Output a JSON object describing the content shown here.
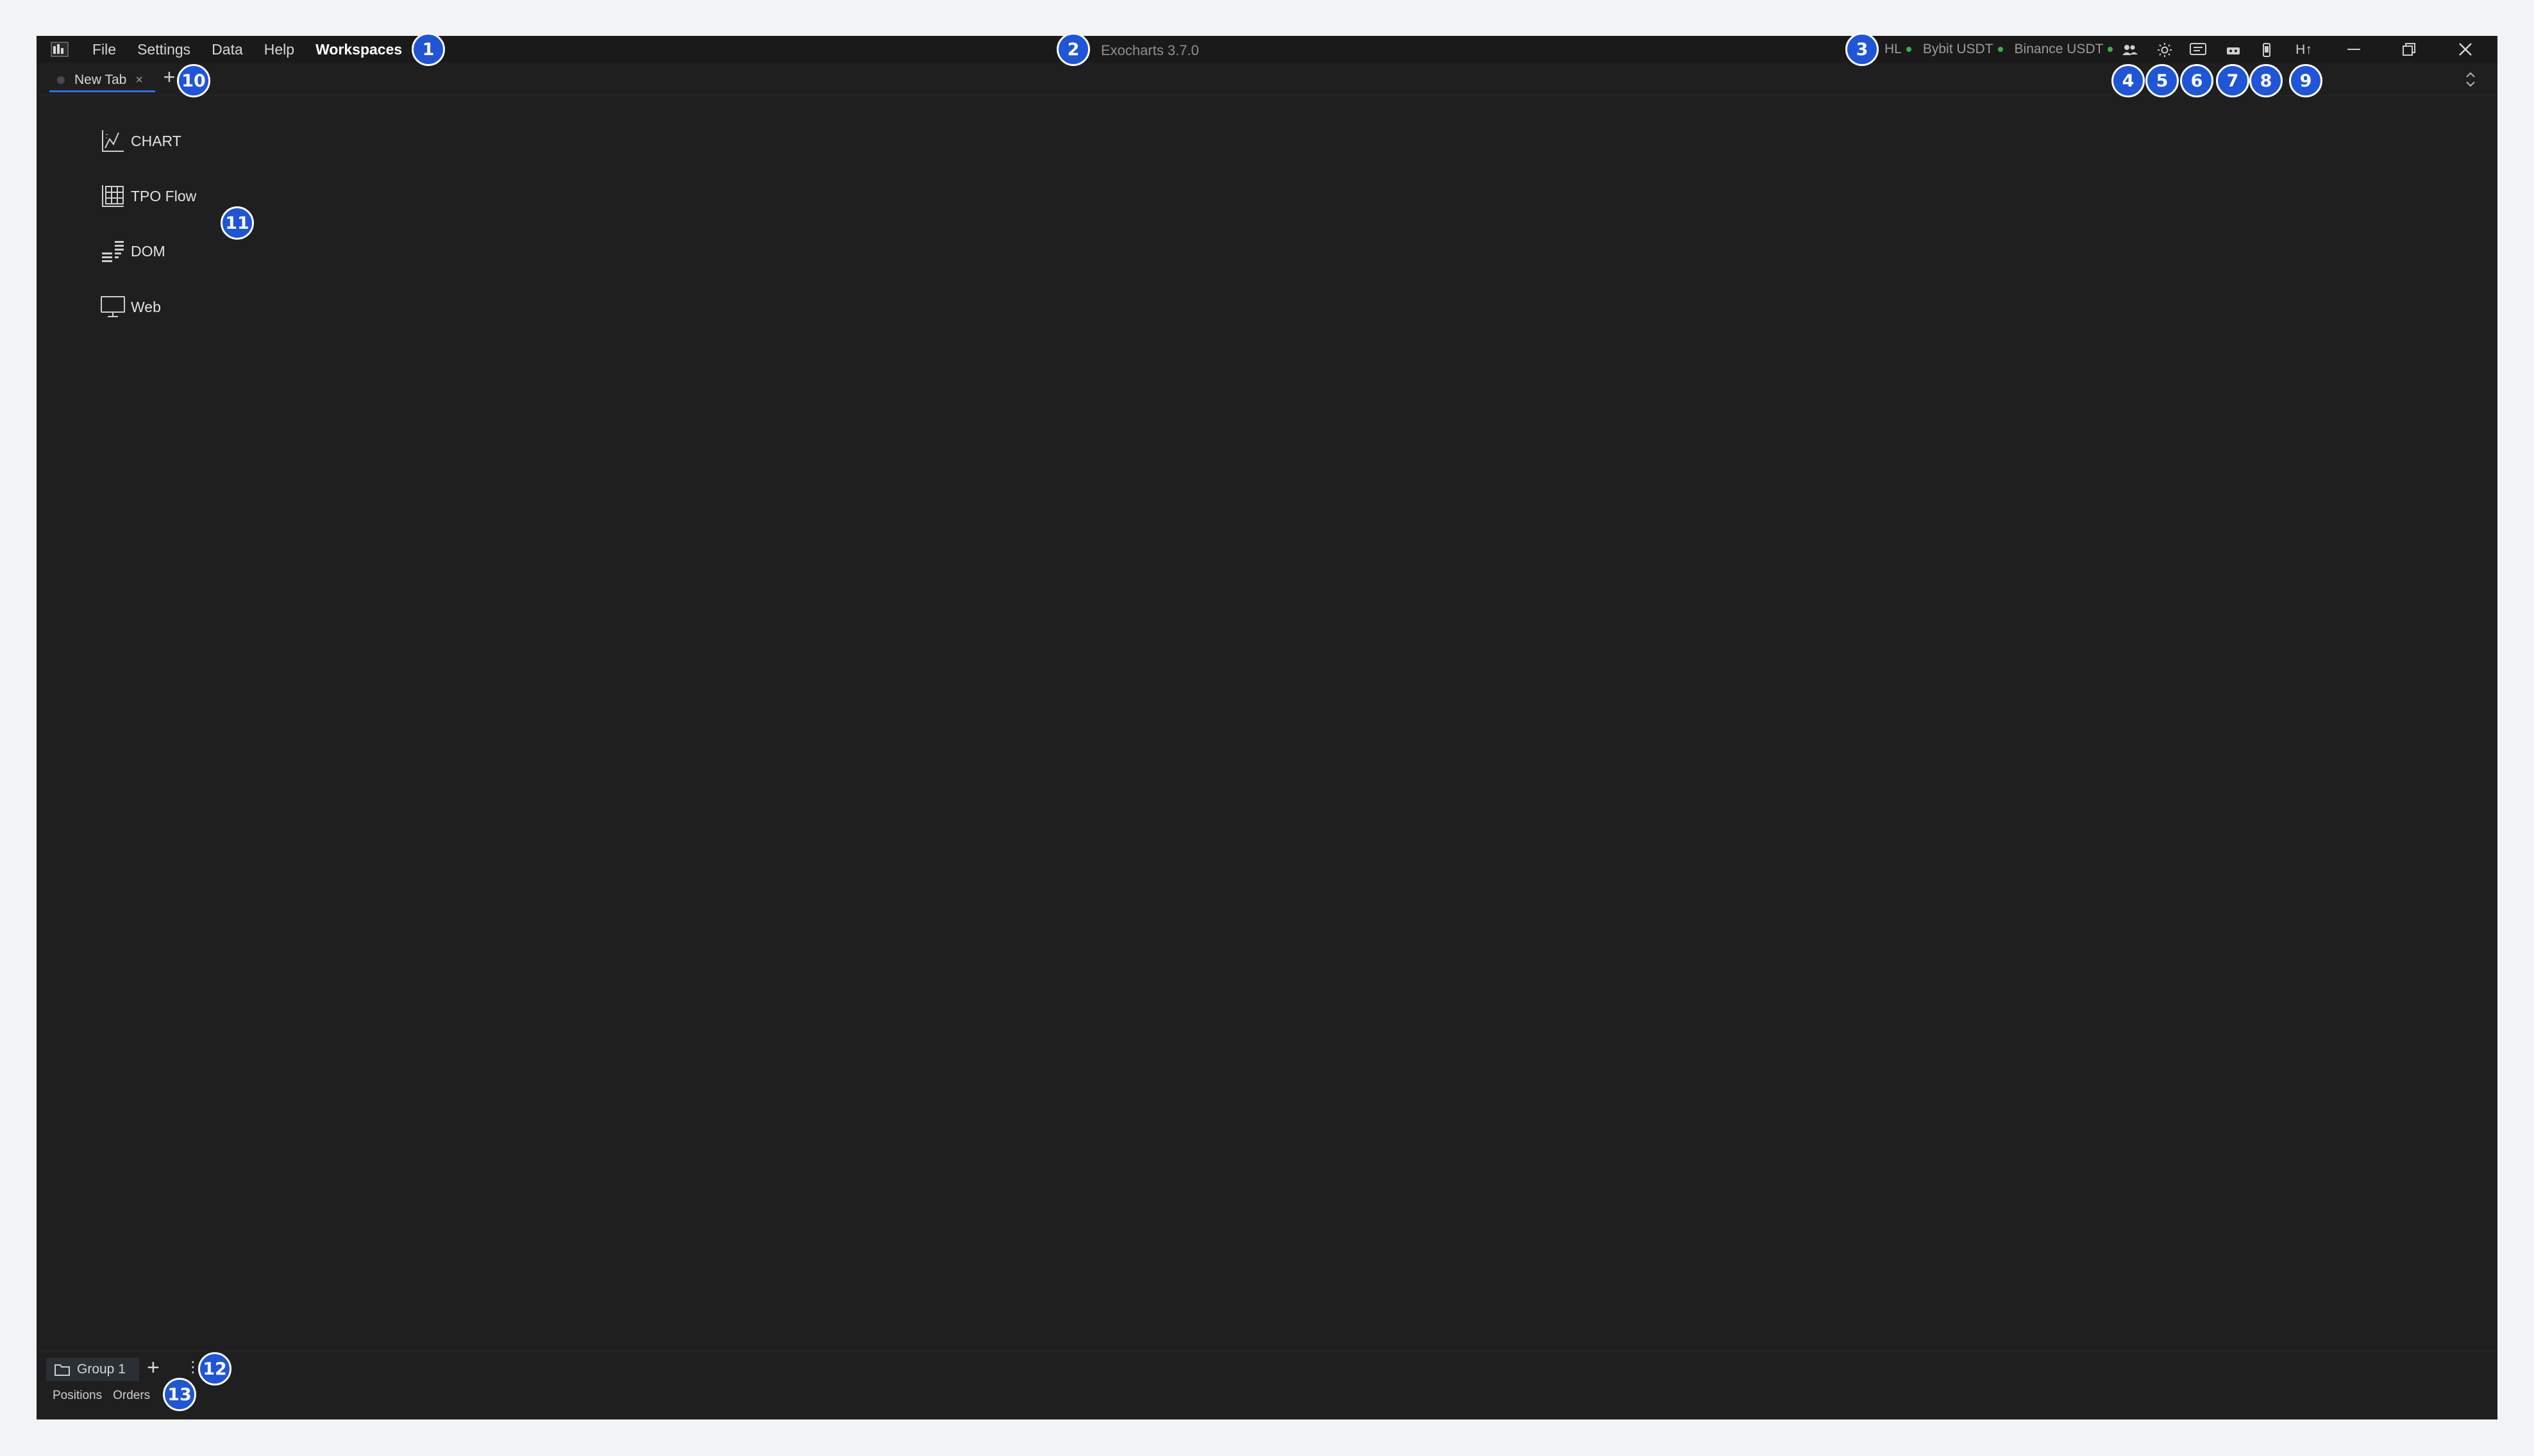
{
  "menu": {
    "items": [
      {
        "label": "File"
      },
      {
        "label": "Settings"
      },
      {
        "label": "Data"
      },
      {
        "label": "Help"
      },
      {
        "label": "Workspaces"
      }
    ]
  },
  "app_title": "Exocharts 3.7.0",
  "connections": [
    {
      "label": "HL",
      "status_color": "#3fae4a"
    },
    {
      "label": "Bybit USDT",
      "status_color": "#3fae4a"
    },
    {
      "label": "Binance USDT",
      "status_color": "#3fae4a"
    }
  ],
  "toolbar": {
    "icons": [
      "users-icon",
      "sun-icon",
      "message-icon",
      "gamepad-icon",
      "phone-icon",
      "height-icon"
    ],
    "height_label": "H↑"
  },
  "tabs": [
    {
      "label": "New Tab",
      "close": "×"
    }
  ],
  "tab_add": "+",
  "panels": [
    {
      "label": "CHART",
      "icon": "line-chart-icon"
    },
    {
      "label": "TPO Flow",
      "icon": "grid-icon"
    },
    {
      "label": "DOM",
      "icon": "list-icon"
    },
    {
      "label": "Web",
      "icon": "monitor-icon"
    }
  ],
  "bottom": {
    "group_label": "Group 1",
    "add": "+",
    "more": "⋮",
    "sub_tabs": [
      {
        "label": "Positions"
      },
      {
        "label": "Orders"
      }
    ]
  },
  "badges": [
    "1",
    "2",
    "3",
    "4",
    "5",
    "6",
    "7",
    "8",
    "9",
    "10",
    "11",
    "12",
    "13"
  ],
  "colors": {
    "accent": "#2f6fde",
    "badge": "#1f55d6",
    "background": "#1f1f1f",
    "connected": "#3fae4a"
  }
}
